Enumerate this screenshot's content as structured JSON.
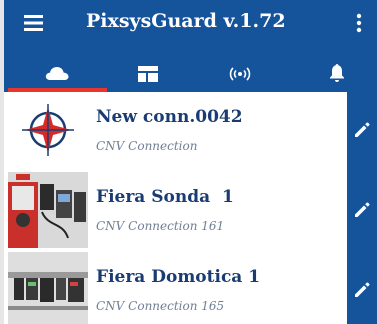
{
  "app": {
    "title": "PixsysGuard v.1.72"
  },
  "tabs": [
    {
      "icon": "cloud-icon",
      "active": true
    },
    {
      "icon": "dashboard-icon",
      "active": false
    },
    {
      "icon": "wireless-signal-icon",
      "active": false
    },
    {
      "icon": "bell-icon",
      "active": false
    }
  ],
  "connections": [
    {
      "title": "New conn.0042",
      "subtitle": "CNV Connection",
      "thumbnail": "crosshair-logo"
    },
    {
      "title": "Fiera Sonda  1",
      "subtitle": "CNV Connection 161",
      "thumbnail": "device-photo"
    },
    {
      "title": "Fiera Domotica 1",
      "subtitle": "CNV Connection 165",
      "thumbnail": "device-photo"
    }
  ],
  "colors": {
    "header": "#15539b",
    "tab_indicator": "#e8352d",
    "title_text": "#1a3c73",
    "subtitle_text": "#6f7f94",
    "logo_red": "#d62a2a"
  }
}
